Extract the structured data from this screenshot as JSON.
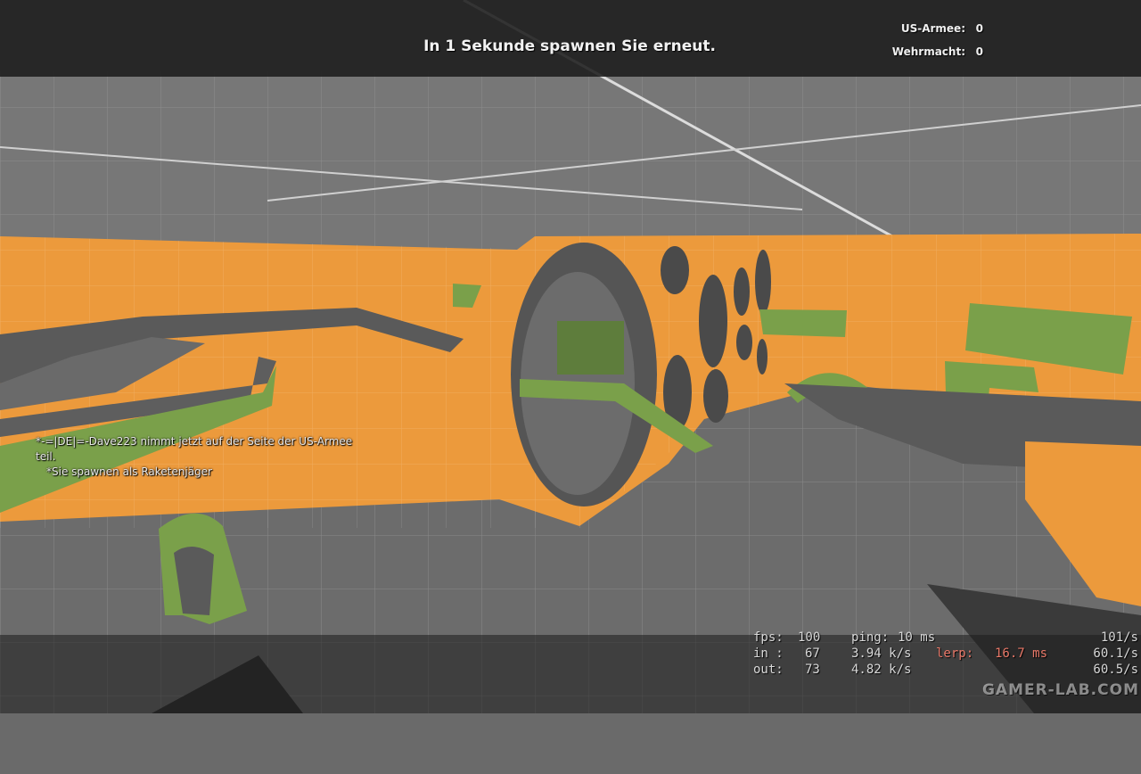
{
  "hud": {
    "spawn_message": "In 1 Sekunde spawnen Sie erneut.",
    "scoreboard": [
      {
        "team": "US-Armee:",
        "score": "0"
      },
      {
        "team": "Wehrmacht:",
        "score": "0"
      }
    ]
  },
  "chat": {
    "lines": [
      "*-=|DE|=-Dave223 nimmt jetzt auf der Seite der US-Armee",
      "teil.",
      "*Sie spawnen als Raketenjäger"
    ]
  },
  "netgraph": {
    "fps_label": "fps:",
    "fps": "100",
    "ping_label": "ping:",
    "ping": "10 ms",
    "rate": "101/s",
    "in_label": "in :",
    "in_val": "67",
    "in_rate": "3.94 k/s",
    "lerp_label": "lerp:",
    "lerp": "16.7 ms",
    "in_freq": "60.1/s",
    "out_label": "out:",
    "out_val": "73",
    "out_rate": "4.82 k/s",
    "out_freq": "60.5/s"
  },
  "watermark": "GAMER-LAB.COM",
  "colors": {
    "orange_wall": "#ec9a3c",
    "green_panel": "#7aa04a",
    "concrete": "#7a7a7a",
    "lerp_text": "#e87868"
  }
}
